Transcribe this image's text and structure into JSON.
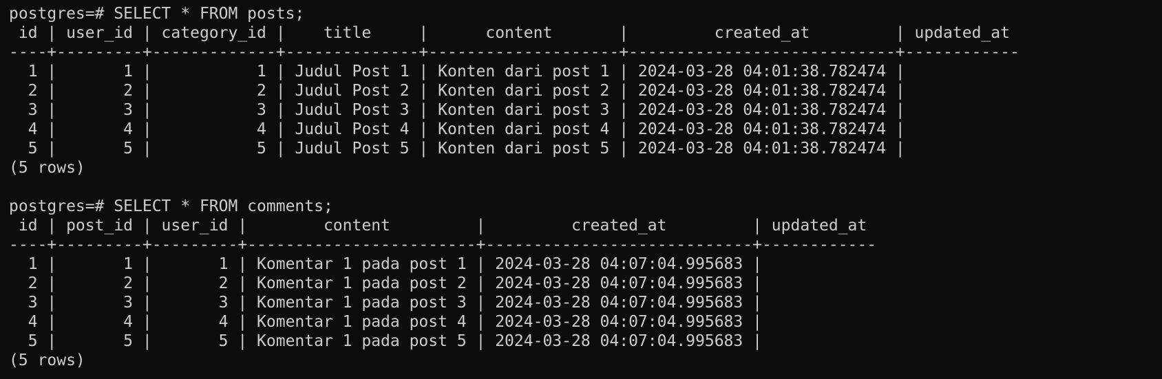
{
  "terminal": {
    "lines": [
      {
        "kind": "prompt",
        "text": "postgres=# SELECT * FROM posts;"
      },
      {
        "kind": "header",
        "text": " id | user_id | category_id |    title     |      content       |         created_at         | updated_at"
      },
      {
        "kind": "separator",
        "text": "----+---------+-------------+--------------+--------------------+----------------------------+------------"
      },
      {
        "kind": "row",
        "text": "  1 |       1 |           1 | Judul Post 1 | Konten dari post 1 | 2024-03-28 04:01:38.782474 |"
      },
      {
        "kind": "row",
        "text": "  2 |       2 |           2 | Judul Post 2 | Konten dari post 2 | 2024-03-28 04:01:38.782474 |"
      },
      {
        "kind": "row",
        "text": "  3 |       3 |           3 | Judul Post 3 | Konten dari post 3 | 2024-03-28 04:01:38.782474 |"
      },
      {
        "kind": "row",
        "text": "  4 |       4 |           4 | Judul Post 4 | Konten dari post 4 | 2024-03-28 04:01:38.782474 |"
      },
      {
        "kind": "row",
        "text": "  5 |       5 |           5 | Judul Post 5 | Konten dari post 5 | 2024-03-28 04:01:38.782474 |"
      },
      {
        "kind": "footer",
        "text": "(5 rows)"
      },
      {
        "kind": "blank",
        "text": ""
      },
      {
        "kind": "prompt",
        "text": "postgres=# SELECT * FROM comments;"
      },
      {
        "kind": "header",
        "text": " id | post_id | user_id |        content         |         created_at         | updated_at"
      },
      {
        "kind": "separator",
        "text": "----+---------+---------+------------------------+----------------------------+------------"
      },
      {
        "kind": "row",
        "text": "  1 |       1 |       1 | Komentar 1 pada post 1 | 2024-03-28 04:07:04.995683 |"
      },
      {
        "kind": "row",
        "text": "  2 |       2 |       2 | Komentar 1 pada post 2 | 2024-03-28 04:07:04.995683 |"
      },
      {
        "kind": "row",
        "text": "  3 |       3 |       3 | Komentar 1 pada post 3 | 2024-03-28 04:07:04.995683 |"
      },
      {
        "kind": "row",
        "text": "  4 |       4 |       4 | Komentar 1 pada post 4 | 2024-03-28 04:07:04.995683 |"
      },
      {
        "kind": "row",
        "text": "  5 |       5 |       5 | Komentar 1 pada post 5 | 2024-03-28 04:07:04.995683 |"
      },
      {
        "kind": "footer",
        "text": "(5 rows)"
      }
    ]
  },
  "colors": {
    "background": "#0c0c0c",
    "foreground": "#cccccc"
  }
}
